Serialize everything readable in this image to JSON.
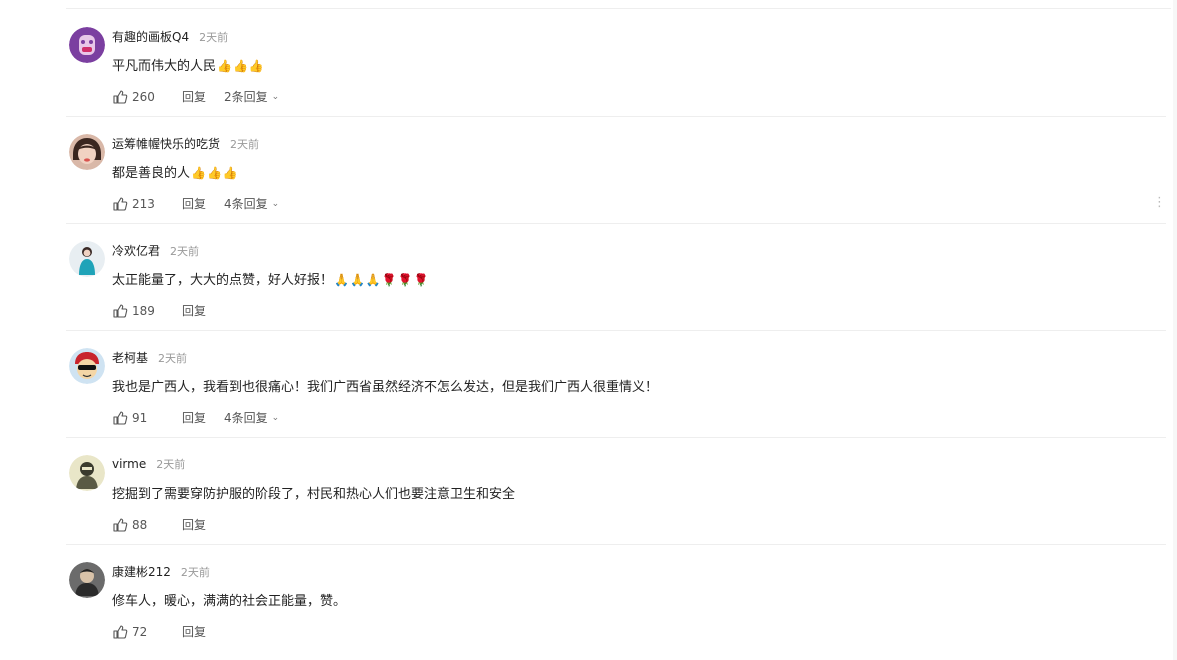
{
  "comments": [
    {
      "username": "有趣的画板Q4",
      "time": "2天前",
      "text": "平凡而伟大的人民",
      "emojis": [
        "👍",
        "👍",
        "👍"
      ],
      "likes": "260",
      "reply_label": "回复",
      "sub_replies": "2条回复"
    },
    {
      "username": "运筹帷幄快乐的吃货",
      "time": "2天前",
      "text": "都是善良的人",
      "emojis": [
        "👍",
        "👍",
        "👍"
      ],
      "likes": "213",
      "reply_label": "回复",
      "sub_replies": "4条回复",
      "more_label": "⋮"
    },
    {
      "username": "冷欢亿君",
      "time": "2天前",
      "text": "太正能量了，大大的点赞，好人好报！",
      "emojis": [
        "🙏",
        "🙏",
        "🙏",
        "🌹",
        "🌹",
        "🌹"
      ],
      "likes": "189",
      "reply_label": "回复"
    },
    {
      "username": "老柯基",
      "time": "2天前",
      "text": "我也是广西人，我看到也很痛心！我们广西省虽然经济不怎么发达，但是我们广西人很重情义！",
      "likes": "91",
      "reply_label": "回复",
      "sub_replies": "4条回复"
    },
    {
      "username": "virme",
      "time": "2天前",
      "text": "挖掘到了需要穿防护服的阶段了，村民和热心人们也要注意卫生和安全",
      "likes": "88",
      "reply_label": "回复"
    },
    {
      "username": "康建彬212",
      "time": "2天前",
      "text": "修车人，暖心，满满的社会正能量，赞。",
      "likes": "72",
      "reply_label": "回复"
    }
  ],
  "icons": {
    "like": "thumbs-up-icon",
    "expand": "chevron-down-icon",
    "more": "more-vertical-icon"
  },
  "colors": {
    "text": "#222222",
    "muted": "#999999",
    "divider": "#eeeeee"
  }
}
